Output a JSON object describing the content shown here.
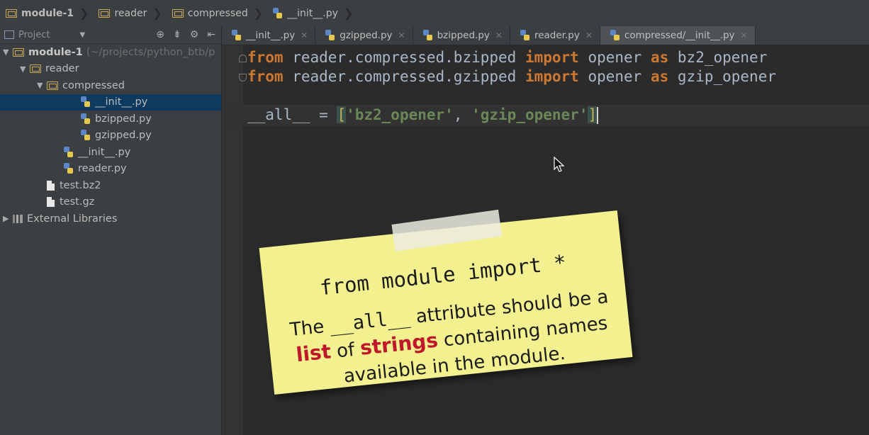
{
  "breadcrumb": [
    {
      "label": "module-1",
      "icon": "folder-icon",
      "bold": true
    },
    {
      "label": "reader",
      "icon": "package-icon"
    },
    {
      "label": "compressed",
      "icon": "package-icon"
    },
    {
      "label": "__init__.py",
      "icon": "python-file-icon"
    }
  ],
  "project_panel": {
    "title": "Project",
    "tree": [
      {
        "label": "module-1",
        "hint": "(~/projects/python_btb/p",
        "indent": 0,
        "toggle": "▼",
        "icon": "folder",
        "bold": true
      },
      {
        "label": "reader",
        "indent": 1,
        "toggle": "▼",
        "icon": "folder"
      },
      {
        "label": "compressed",
        "indent": 2,
        "toggle": "▼",
        "icon": "folder"
      },
      {
        "label": "__init__.py",
        "indent": 4,
        "icon": "py",
        "selected": true
      },
      {
        "label": "bzipped.py",
        "indent": 4,
        "icon": "py"
      },
      {
        "label": "gzipped.py",
        "indent": 4,
        "icon": "py"
      },
      {
        "label": "__init__.py",
        "indent": 3,
        "icon": "py"
      },
      {
        "label": "reader.py",
        "indent": 3,
        "icon": "py"
      },
      {
        "label": "test.bz2",
        "indent": 2,
        "icon": "file"
      },
      {
        "label": "test.gz",
        "indent": 2,
        "icon": "file"
      },
      {
        "label": "External Libraries",
        "indent": 0,
        "toggle": "▶",
        "icon": "lib"
      }
    ]
  },
  "tabs": [
    {
      "label": "__init__.py",
      "active": false
    },
    {
      "label": "gzipped.py",
      "active": false
    },
    {
      "label": "bzipped.py",
      "active": false
    },
    {
      "label": "reader.py",
      "active": false
    },
    {
      "label": "compressed/__init__.py",
      "active": true
    }
  ],
  "code": {
    "line1": {
      "kw1": "from",
      "mod": " reader.compressed.bzipped ",
      "kw2": "import",
      "name": " opener ",
      "kw3": "as",
      "alias": " bz2_opener"
    },
    "line2": {
      "kw1": "from",
      "mod": " reader.compressed.gzipped ",
      "kw2": "import",
      "name": " opener ",
      "kw3": "as",
      "alias": " gzip_opener"
    },
    "line4": {
      "lhs": "__all__ = ",
      "open": "[",
      "s1": "'bz2_opener'",
      "comma": ", ",
      "s2": "'gzip_opener'",
      "close": "]"
    }
  },
  "note": {
    "title": "from module import *",
    "body_1": "The ",
    "body_mono": "__all__",
    "body_2": " attribute should be a",
    "body_red1": "list",
    "body_3": " of ",
    "body_red2": "strings",
    "body_4": " containing names",
    "body_5": "available in the module."
  },
  "colors": {
    "keyword": "#cc7832",
    "string": "#6a8759",
    "note_bg": "#f3f08f",
    "highlight": "#c0182b"
  }
}
